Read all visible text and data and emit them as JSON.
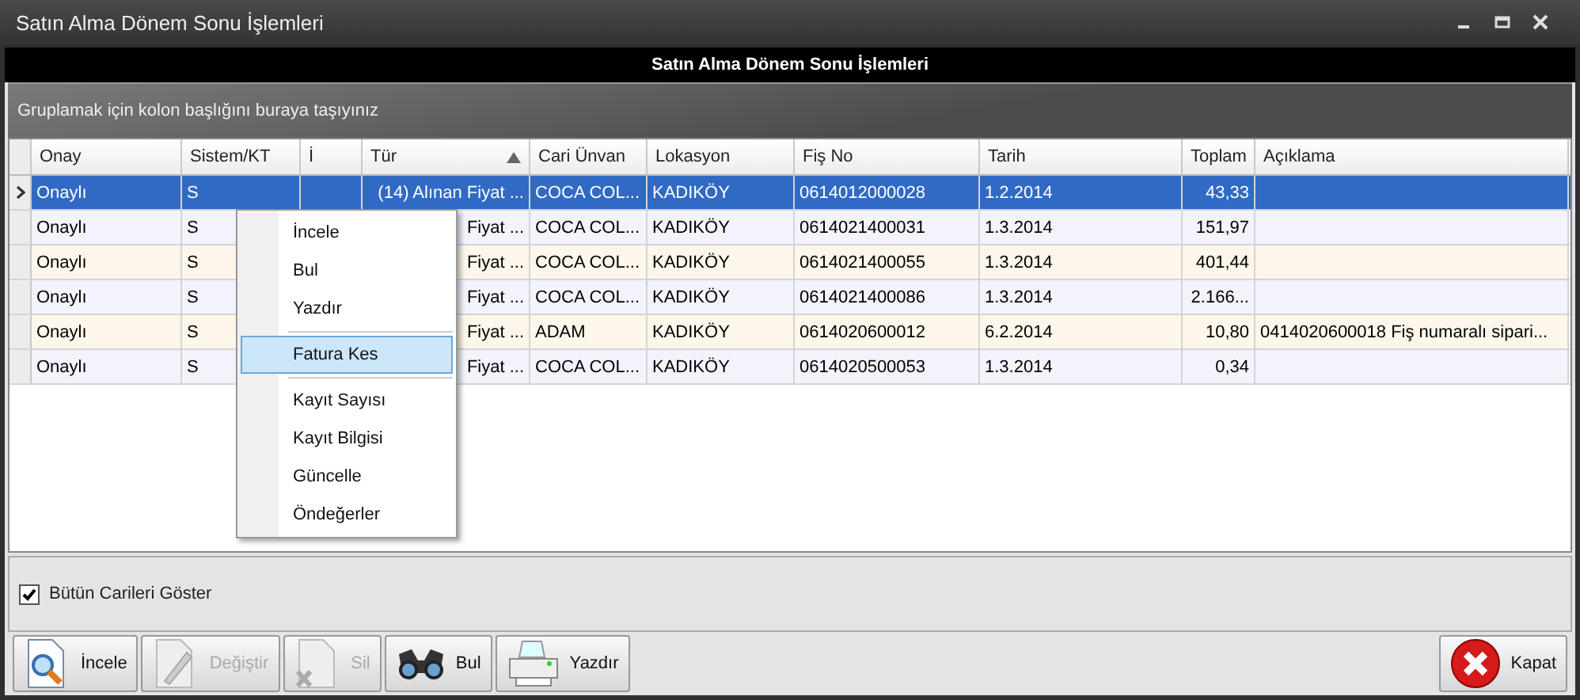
{
  "window": {
    "title": "Satın Alma Dönem Sonu İşlemleri",
    "controls": [
      {
        "kind": "minimize"
      },
      {
        "kind": "maximize"
      },
      {
        "kind": "close"
      }
    ]
  },
  "header": {
    "title": "Satın Alma Dönem Sonu İşlemleri"
  },
  "group_panel": {
    "hint": "Gruplamak için kolon başlığını buraya taşıyınız"
  },
  "table": {
    "columns": [
      {
        "label": "Onay",
        "sorted": false
      },
      {
        "label": "Sistem/KT",
        "sorted": false
      },
      {
        "label": "İ",
        "sorted": false
      },
      {
        "label": "Tür",
        "sorted": true
      },
      {
        "label": "Cari Ünvan",
        "sorted": false
      },
      {
        "label": "Lokasyon",
        "sorted": false
      },
      {
        "label": "Fiş No",
        "sorted": false
      },
      {
        "label": "Tarih",
        "sorted": false
      },
      {
        "label": "Toplam",
        "sorted": false
      },
      {
        "label": "Açıklama",
        "sorted": false
      }
    ],
    "rows": [
      {
        "selected": true,
        "cells": [
          "Onaylı",
          "S",
          "",
          "(14) Alınan Fiyat ...",
          "COCA COL...",
          "KADIKÖY",
          "0614012000028",
          "1.2.2014",
          "43,33",
          ""
        ]
      },
      {
        "selected": false,
        "cells": [
          "Onaylı",
          "S",
          "",
          "Fiyat ...",
          "COCA COL...",
          "KADIKÖY",
          "0614021400031",
          "1.3.2014",
          "151,97",
          ""
        ]
      },
      {
        "selected": false,
        "cells": [
          "Onaylı",
          "S",
          "",
          "Fiyat ...",
          "COCA COL...",
          "KADIKÖY",
          "0614021400055",
          "1.3.2014",
          "401,44",
          ""
        ]
      },
      {
        "selected": false,
        "cells": [
          "Onaylı",
          "S",
          "",
          "Fiyat ...",
          "COCA COL...",
          "KADIKÖY",
          "0614021400086",
          "1.3.2014",
          "2.166...",
          ""
        ]
      },
      {
        "selected": false,
        "cells": [
          "Onaylı",
          "S",
          "",
          "Fiyat ...",
          "ADAM",
          "KADIKÖY",
          "0614020600012",
          "6.2.2014",
          "10,80",
          "0414020600018 Fiş numaralı sipari..."
        ]
      },
      {
        "selected": false,
        "cells": [
          "Onaylı",
          "S",
          "",
          "Fiyat ...",
          "COCA COL...",
          "KADIKÖY",
          "0614020500053",
          "1.3.2014",
          "0,34",
          ""
        ]
      }
    ]
  },
  "context_menu": {
    "items": [
      {
        "kind": "item",
        "label": "İncele",
        "selected": false
      },
      {
        "kind": "item",
        "label": "Bul",
        "selected": false
      },
      {
        "kind": "item",
        "label": "Yazdır",
        "selected": false
      },
      {
        "kind": "separator"
      },
      {
        "kind": "item",
        "label": "Fatura Kes",
        "selected": true
      },
      {
        "kind": "separator"
      },
      {
        "kind": "item",
        "label": "Kayıt Sayısı",
        "selected": false
      },
      {
        "kind": "item",
        "label": "Kayıt Bilgisi",
        "selected": false
      },
      {
        "kind": "item",
        "label": "Güncelle",
        "selected": false
      },
      {
        "kind": "item",
        "label": "Öndeğerler",
        "selected": false
      }
    ]
  },
  "options": {
    "show_all": {
      "label": "Bütün Carileri Göster",
      "checked": true
    }
  },
  "buttons": [
    {
      "kind": "inspect",
      "label": "İncele",
      "disabled": false
    },
    {
      "kind": "edit",
      "label": "Değiştir",
      "disabled": true
    },
    {
      "kind": "delete",
      "label": "Sil",
      "disabled": true
    },
    {
      "kind": "find",
      "label": "Bul",
      "disabled": false
    },
    {
      "kind": "print",
      "label": "Yazdır",
      "disabled": false
    }
  ],
  "close_button": {
    "kind": "close",
    "label": "Kapat",
    "disabled": false
  }
}
